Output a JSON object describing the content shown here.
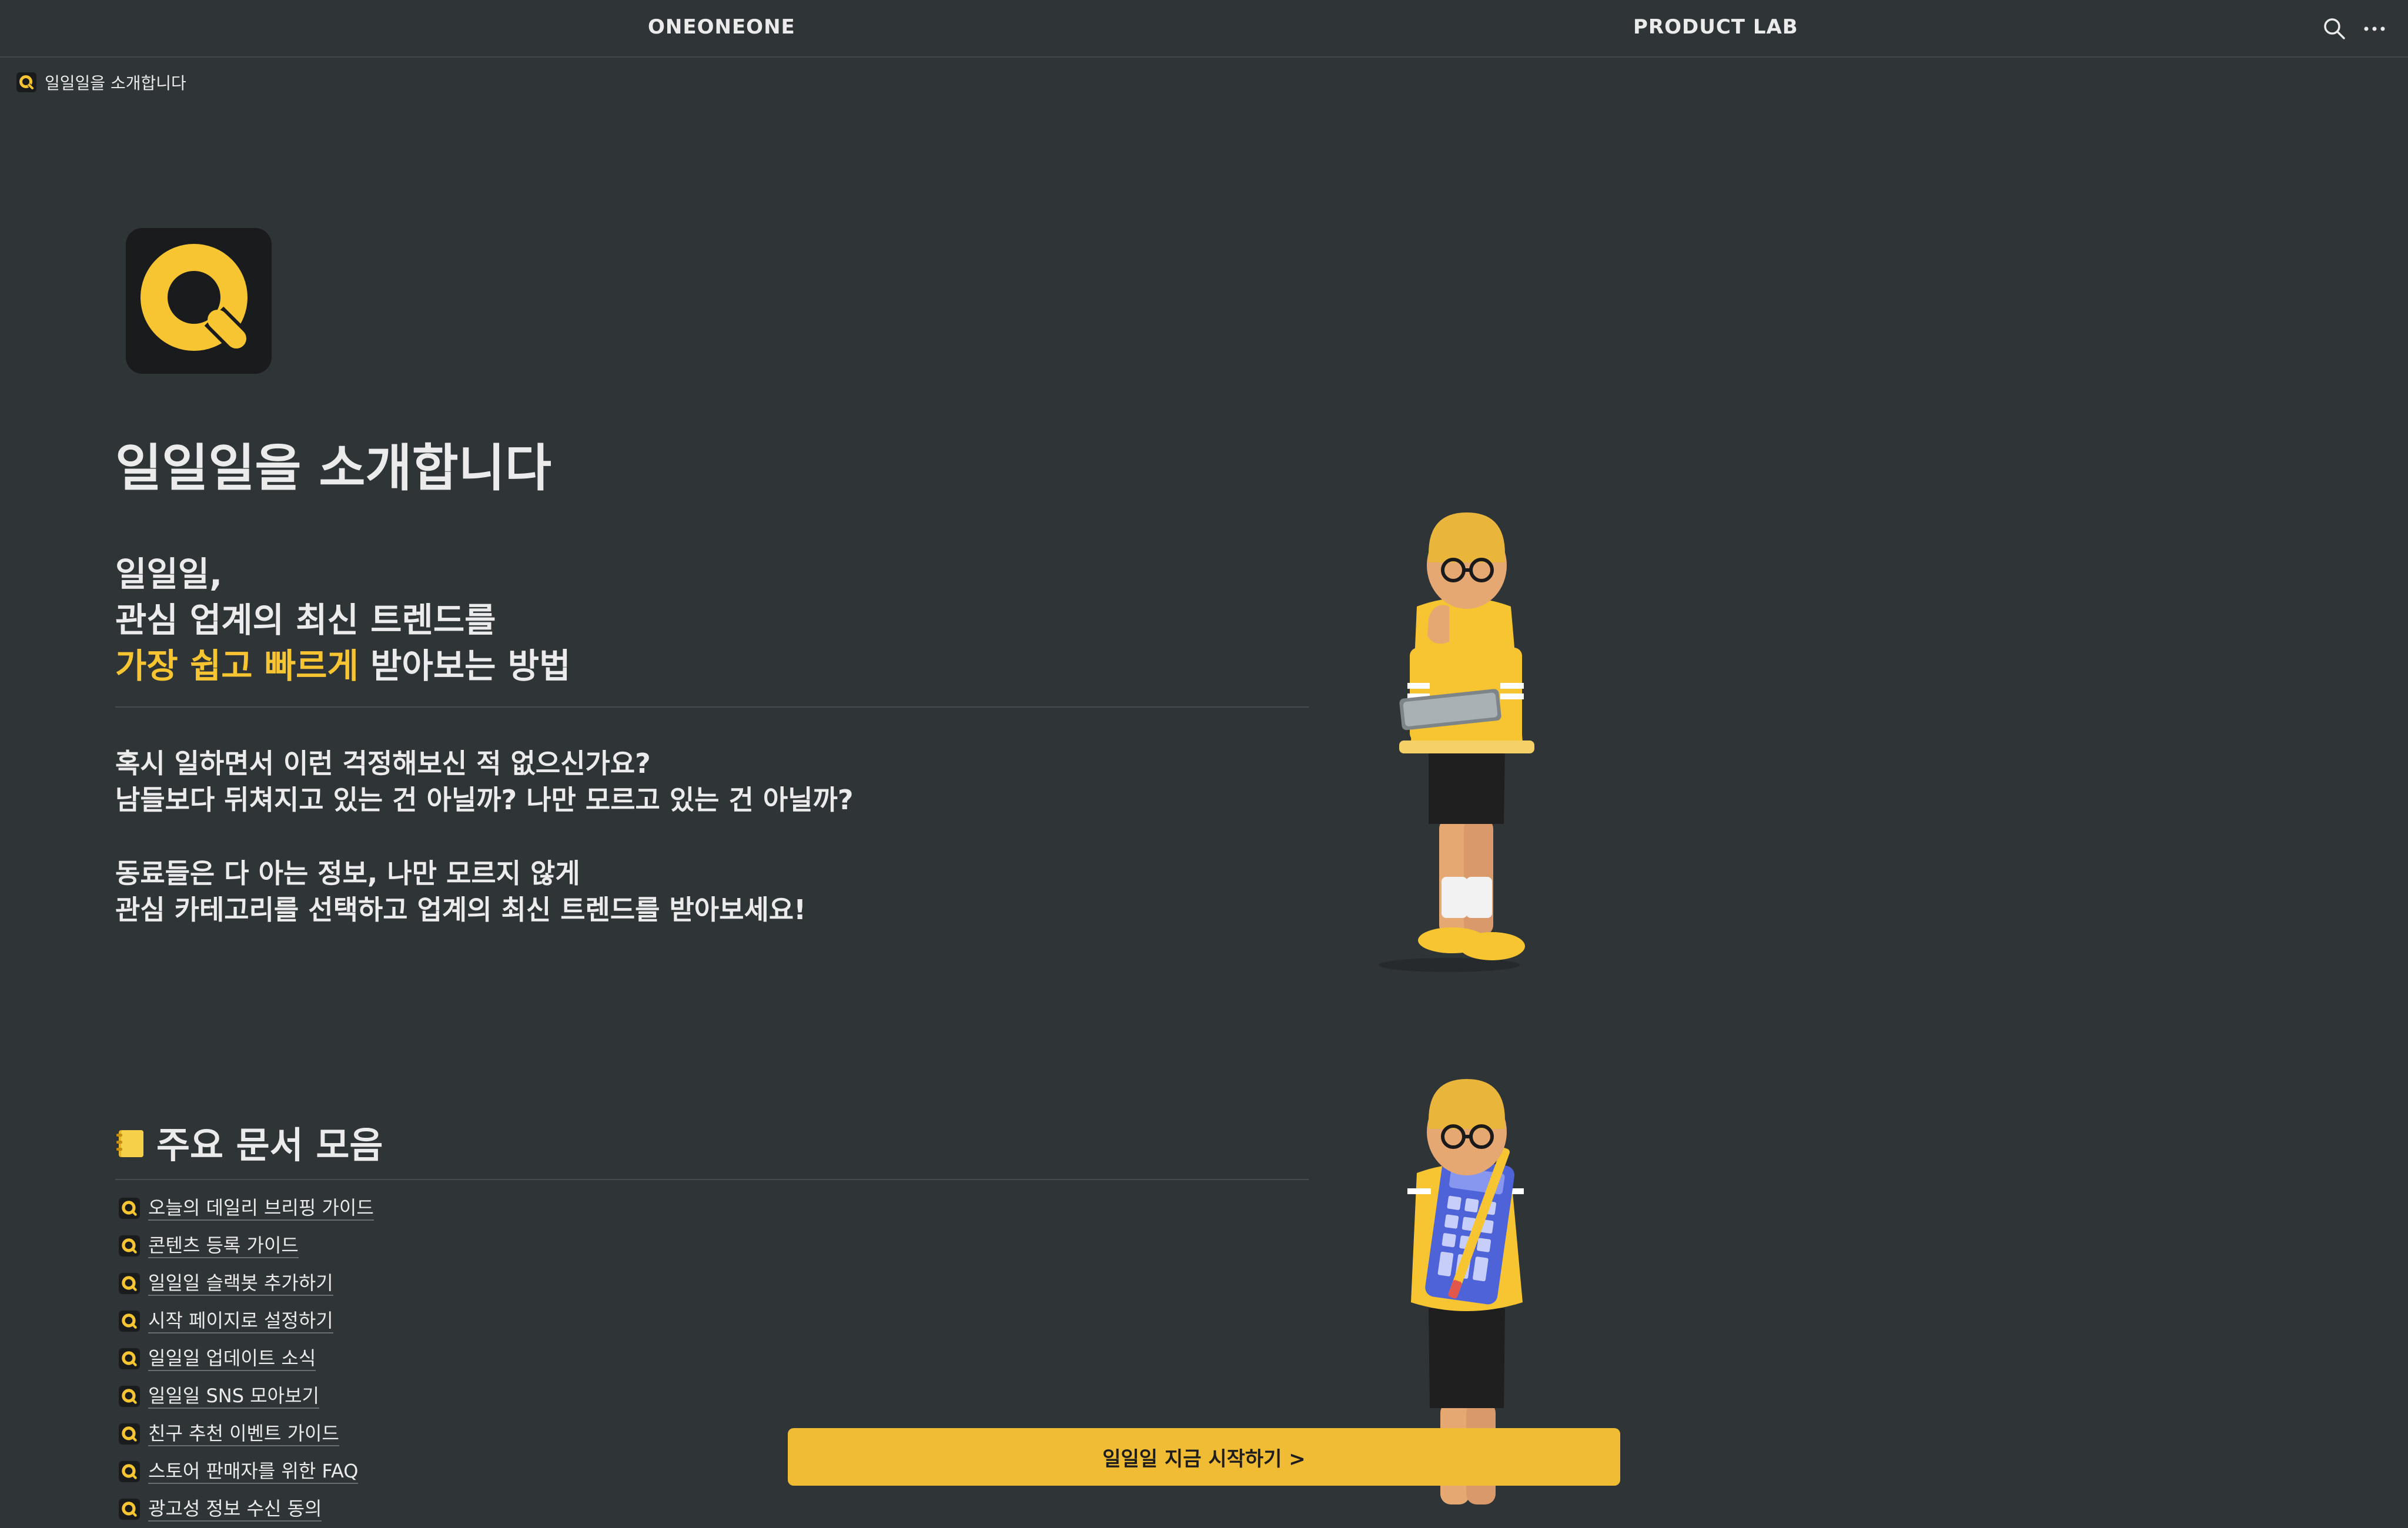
{
  "topbar": {
    "nav_left": "ONEONEONE",
    "nav_right": "PRODUCT LAB",
    "search_icon": "search-icon",
    "more_icon": "more-horizontal-icon"
  },
  "breadcrumb": {
    "label": "일일일을 소개합니다"
  },
  "page": {
    "title": "일일일을 소개합니다",
    "headline": {
      "line1": "일일일,",
      "line2": "관심 업계의 최신 트렌드를",
      "line3_highlight": "가장 쉽고 빠르게",
      "line3_rest": " 받아보는 방법"
    },
    "para1": {
      "line1": "혹시 일하면서 이런 걱정해보신 적 없으신가요?",
      "line2": "남들보다 뒤쳐지고 있는 건 아닐까? 나만 모르고 있는 건 아닐까?"
    },
    "para2": {
      "line1": "동료들은 다 아는 정보, 나만 모르지 않게",
      "line2": "관심 카테고리를 선택하고 업계의 최신 트렌드를 받아보세요!"
    }
  },
  "docs_section": {
    "title": "주요 문서 모음",
    "icon": "notebook-icon",
    "items": [
      {
        "label": "오늘의 데일리 브리핑 가이드"
      },
      {
        "label": "콘텐츠 등록 가이드"
      },
      {
        "label": "일일일 슬랙봇 추가하기"
      },
      {
        "label": "시작 페이지로 설정하기"
      },
      {
        "label": "일일일 업데이트 소식"
      },
      {
        "label": "일일일 SNS 모아보기"
      },
      {
        "label": "친구 추천 이벤트 가이드"
      },
      {
        "label": "스토어 판매자를 위한 FAQ"
      },
      {
        "label": "광고성 정보 수신 동의"
      }
    ]
  },
  "cta": {
    "label": "일일일 지금 시작하기 >"
  },
  "colors": {
    "background": "#2f3437",
    "accent": "#f6c531",
    "cta": "#f0bc34",
    "logo_bg": "#191b1d"
  }
}
